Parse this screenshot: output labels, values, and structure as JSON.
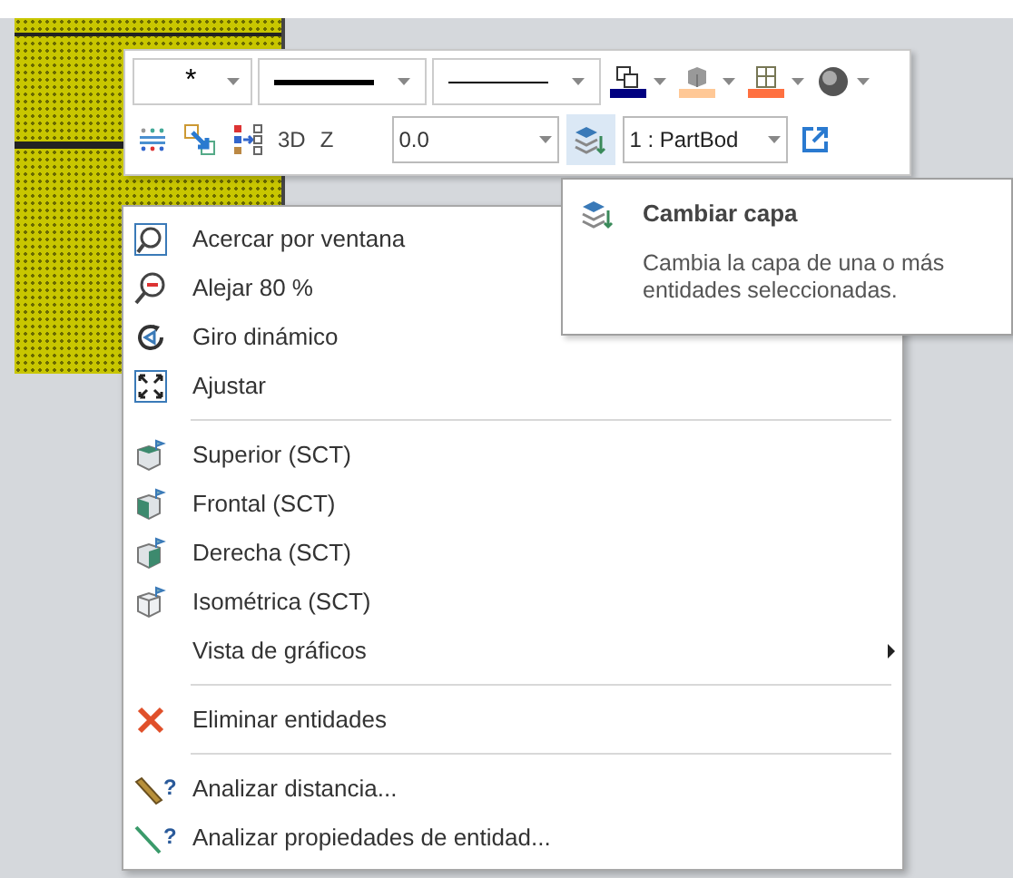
{
  "toolbar": {
    "row1": [
      {
        "kind": "dropdown",
        "text": "*"
      },
      {
        "kind": "line_dropdown"
      },
      {
        "kind": "line_dropdown"
      },
      {
        "kind": "color_button",
        "color": "#000080"
      },
      {
        "kind": "color_button",
        "color": "#ffc896"
      },
      {
        "kind": "color_button",
        "color": "#ff7040"
      },
      {
        "kind": "plain_button"
      }
    ],
    "row2": [
      {
        "kind": "icon",
        "selected": false
      },
      {
        "kind": "icon",
        "selected": false
      },
      {
        "kind": "icon",
        "selected": false
      },
      {
        "kind": "text",
        "text": "3D"
      },
      {
        "kind": "text",
        "text": "Z"
      },
      {
        "kind": "field",
        "value": "0.0"
      },
      {
        "kind": "icon",
        "selected": true
      },
      {
        "kind": "dropdown",
        "text": "1 : PartBod"
      },
      {
        "kind": "icon",
        "selected": false
      }
    ]
  },
  "tooltip": {
    "title": "Cambiar capa",
    "description": "Cambia la capa de una o más entidades seleccionadas."
  },
  "menu": [
    {
      "kind": "item",
      "label": "Acercar por ventana"
    },
    {
      "kind": "item",
      "label": "Alejar 80 %"
    },
    {
      "kind": "item",
      "label": "Giro dinámico"
    },
    {
      "kind": "item",
      "label": "Ajustar"
    },
    {
      "kind": "separator"
    },
    {
      "kind": "item",
      "label": "Superior (SCT)"
    },
    {
      "kind": "item",
      "label": "Frontal (SCT)"
    },
    {
      "kind": "item",
      "label": "Derecha (SCT)"
    },
    {
      "kind": "item",
      "label": "Isométrica (SCT)"
    },
    {
      "kind": "submenu",
      "label": "Vista de gráficos"
    },
    {
      "kind": "separator"
    },
    {
      "kind": "item",
      "label": "Eliminar entidades"
    },
    {
      "kind": "separator"
    },
    {
      "kind": "item",
      "mark": "?",
      "label": "Analizar distancia..."
    },
    {
      "kind": "item",
      "mark": "?",
      "label": "Analizar propiedades de entidad..."
    }
  ]
}
